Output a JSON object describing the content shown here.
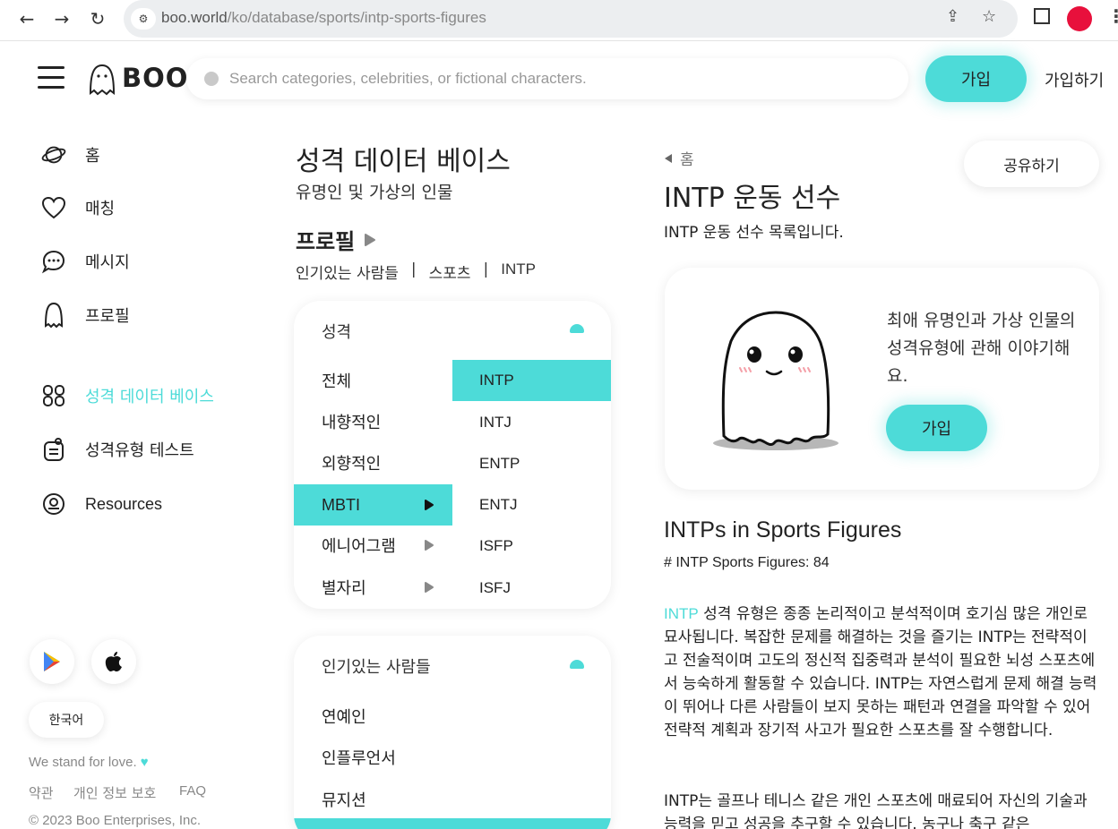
{
  "browser": {
    "url_host": "boo.world",
    "url_path": "/ko/database/sports/intp-sports-figures"
  },
  "header": {
    "logo_text": "BOO",
    "search_placeholder": "Search categories, celebrities, or fictional characters.",
    "join_label": "가입",
    "signup_label": "가입하기"
  },
  "sidebar": {
    "items": [
      {
        "label": "홈",
        "icon": "planet-icon"
      },
      {
        "label": "매칭",
        "icon": "heart-icon"
      },
      {
        "label": "메시지",
        "icon": "chat-bubble-icon"
      },
      {
        "label": "프로필",
        "icon": "ghost-outline-icon"
      },
      {
        "label": "성격 데이터 베이스",
        "icon": "database-grid-icon",
        "active": true
      },
      {
        "label": "성격유형 테스트",
        "icon": "test-icon"
      },
      {
        "label": "Resources",
        "icon": "resources-icon"
      }
    ],
    "language": "한국어",
    "tagline": "We stand for love.",
    "footer_links": [
      "약관",
      "개인 정보 보호",
      "FAQ"
    ],
    "copyright": "© 2023 Boo Enterprises, Inc."
  },
  "middle": {
    "title": "성격 데이터 베이스",
    "subtitle": "유명인 및 가상의 인물",
    "profile_heading": "프로필",
    "breadcrumbs": [
      "인기있는 사람들",
      "|",
      "스포츠",
      "|",
      "INTP"
    ],
    "filter_card": {
      "heading": "성격",
      "categories": [
        "전체",
        "내향적인",
        "외향적인",
        "MBTI",
        "에니어그램",
        "별자리"
      ],
      "selected_category": "MBTI",
      "types": [
        "INTP",
        "INTJ",
        "ENTP",
        "ENTJ",
        "ISFP",
        "ISFJ"
      ],
      "selected_type": "INTP"
    },
    "popular_card": {
      "heading": "인기있는 사람들",
      "items": [
        "연예인",
        "인플루언서",
        "뮤지션"
      ]
    }
  },
  "right": {
    "back_label": "홈",
    "share_label": "공유하기",
    "title": "INTP 운동 선수",
    "description": "INTP 운동 선수 목록입니다.",
    "promo": {
      "text": "최애 유명인과 가상 인물의 성격유형에 관해 이야기해요.",
      "join_label": "가입"
    },
    "section_title": "INTPs in Sports Figures",
    "count_line": "# INTP Sports Figures: 84",
    "para1_highlight": "INTP",
    "para1_rest": " 성격 유형은 종종 논리적이고 분석적이며 호기심 많은 개인로 묘사됩니다. 복잡한 문제를 해결하는 것을 즐기는 INTP는 전략적이고 전술적이며 고도의 정신적 집중력과 분석이 필요한 뇌성 스포츠에서 능숙하게 활동할 수 있습니다. INTP는 자연스럽게 문제 해결 능력이 뛰어나 다른 사람들이 보지 못하는 패턴과 연결을 파악할 수 있어 전략적 계획과 장기적 사고가 필요한 스포츠를 잘 수행합니다.",
    "para2": "INTP는 골프나 테니스 같은 개인 스포츠에 매료되어 자신의 기술과 능력을 믿고 성공을 추구할 수 있습니다. 농구나 축구 같은"
  },
  "colors": {
    "accent": "#4ddbd8",
    "profile_dot": "#e8103c"
  }
}
